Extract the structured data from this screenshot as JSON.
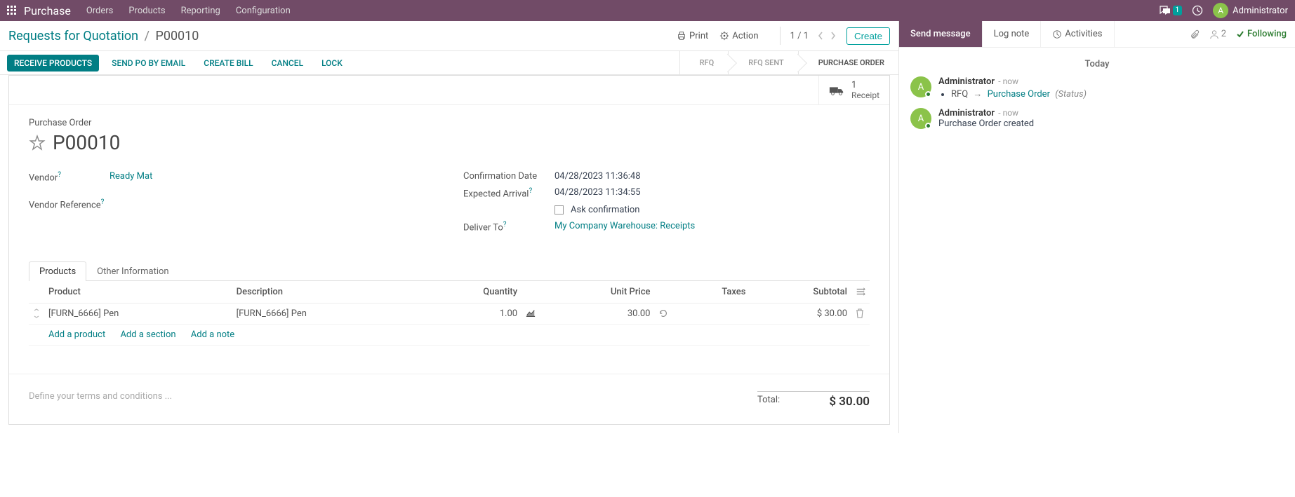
{
  "navbar": {
    "app": "Purchase",
    "menus": [
      "Orders",
      "Products",
      "Reporting",
      "Configuration"
    ],
    "msg_badge": "1",
    "user": "Administrator",
    "user_initial": "A"
  },
  "breadcrumb": {
    "parent": "Requests for Quotation",
    "current": "P00010"
  },
  "control": {
    "print": "Print",
    "action": "Action",
    "pager": "1 / 1",
    "create": "Create"
  },
  "statusbar": {
    "buttons": [
      "RECEIVE PRODUCTS",
      "SEND PO BY EMAIL",
      "CREATE BILL",
      "CANCEL",
      "LOCK"
    ],
    "steps": [
      "RFQ",
      "RFQ SENT",
      "PURCHASE ORDER"
    ]
  },
  "stat_button": {
    "count": "1",
    "label": "Receipt"
  },
  "record": {
    "doc_type": "Purchase Order",
    "name": "P00010",
    "vendor_label": "Vendor",
    "vendor": "Ready Mat",
    "vendor_ref_label": "Vendor Reference",
    "confirm_label": "Confirmation Date",
    "confirm": "04/28/2023 11:36:48",
    "expected_label": "Expected Arrival",
    "expected": "04/28/2023 11:34:55",
    "ask_confirm": "Ask confirmation",
    "deliver_label": "Deliver To",
    "deliver": "My Company Warehouse: Receipts"
  },
  "tabs": {
    "products": "Products",
    "other": "Other Information"
  },
  "lines": {
    "headers": {
      "product": "Product",
      "description": "Description",
      "quantity": "Quantity",
      "unit_price": "Unit Price",
      "taxes": "Taxes",
      "subtotal": "Subtotal"
    },
    "rows": [
      {
        "product": "[FURN_6666] Pen",
        "description": "[FURN_6666] Pen",
        "qty": "1.00",
        "price": "30.00",
        "subtotal": "$ 30.00"
      }
    ],
    "add_product": "Add a product",
    "add_section": "Add a section",
    "add_note": "Add a note"
  },
  "terms_placeholder": "Define your terms and conditions ...",
  "totals": {
    "label": "Total:",
    "value": "$ 30.00"
  },
  "chatter": {
    "send": "Send message",
    "log": "Log note",
    "activities": "Activities",
    "followers": "2",
    "following": "Following",
    "today": "Today",
    "messages": [
      {
        "author": "Administrator",
        "time": "- now",
        "type": "change",
        "field": "RFQ",
        "new_val": "Purchase Order",
        "note": "(Status)"
      },
      {
        "author": "Administrator",
        "time": "- now",
        "type": "text",
        "body": "Purchase Order created"
      }
    ]
  }
}
